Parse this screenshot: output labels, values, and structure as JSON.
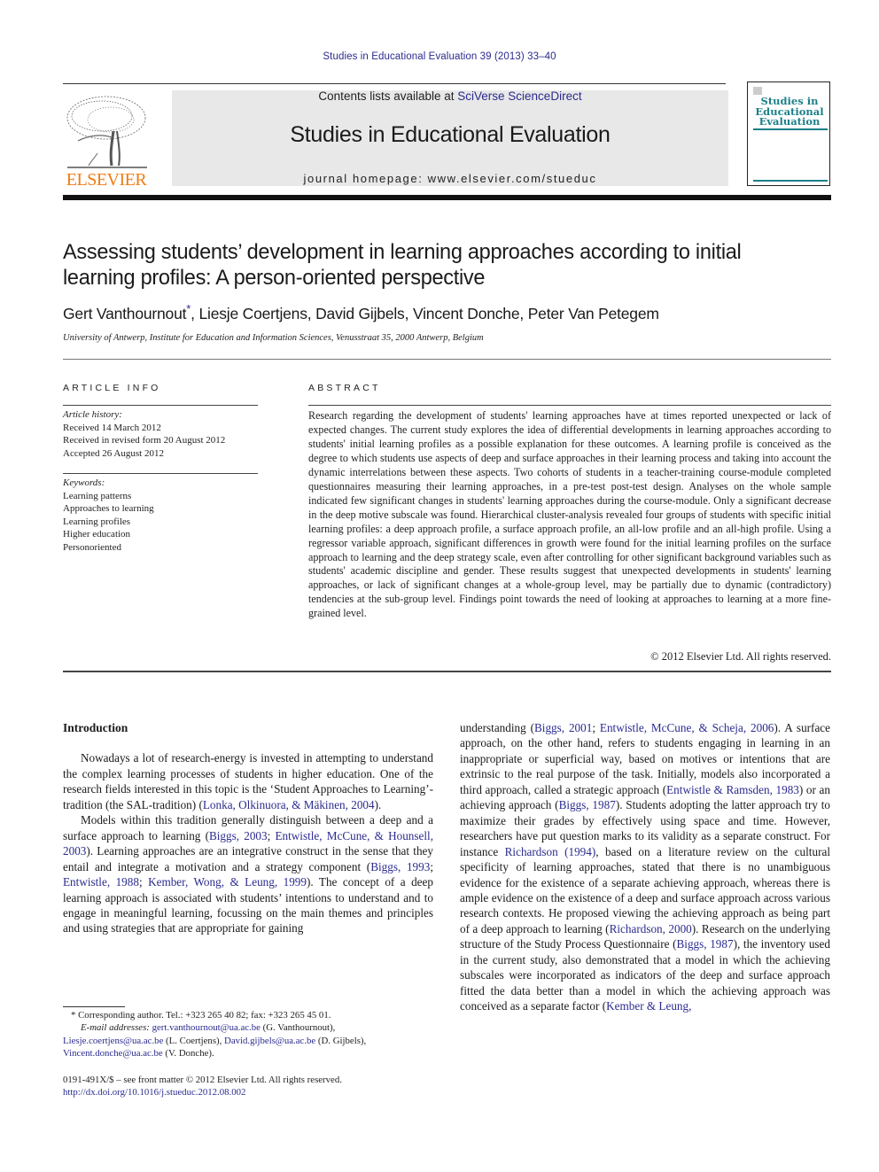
{
  "header": {
    "journal_ref": "Studies in Educational Evaluation 39 (2013) 33–40",
    "contents_prefix": "Contents lists available at ",
    "contents_link": "SciVerse ScienceDirect",
    "journal_title": "Studies in Educational Evaluation",
    "homepage": "journal homepage: www.elsevier.com/stueduc",
    "publisher_logo": "ELSEVIER",
    "cover_title": "Studies in Educational Evaluation",
    "colors": {
      "link": "#2b2b8f",
      "elsevier_orange": "#f07c14",
      "cover_teal": "#1b7f88",
      "banner_bg": "#e8e8e8"
    }
  },
  "article": {
    "title": "Assessing students’ development in learning approaches according to initial learning profiles: A person-oriented perspective",
    "authors": [
      {
        "name": "Gert Vanthournout",
        "mark": "*"
      },
      {
        "name": "Liesje Coertjens"
      },
      {
        "name": "David Gijbels"
      },
      {
        "name": "Vincent Donche"
      },
      {
        "name": "Peter Van Petegem"
      }
    ],
    "affiliation": "University of Antwerp, Institute for Education and Information Sciences, Venusstraat 35, 2000 Antwerp, Belgium"
  },
  "article_info": {
    "heading": "ARTICLE INFO",
    "history_label": "Article history:",
    "history": [
      "Received 14 March 2012",
      "Received in revised form 20 August 2012",
      "Accepted 26 August 2012"
    ],
    "keywords_label": "Keywords:",
    "keywords": [
      "Learning patterns",
      "Approaches to learning",
      "Learning profiles",
      "Higher education",
      "Personoriented"
    ]
  },
  "abstract": {
    "heading": "ABSTRACT",
    "text": "Research regarding the development of students' learning approaches have at times reported unexpected or lack of expected changes. The current study explores the idea of differential developments in learning approaches according to students' initial learning profiles as a possible explanation for these outcomes. A learning profile is conceived as the degree to which students use aspects of deep and surface approaches in their learning process and taking into account the dynamic interrelations between these aspects. Two cohorts of students in a teacher-training course-module completed questionnaires measuring their learning approaches, in a pre-test post-test design. Analyses on the whole sample indicated few significant changes in students' learning approaches during the course-module. Only a significant decrease in the deep motive subscale was found. Hierarchical cluster-analysis revealed four groups of students with specific initial learning profiles: a deep approach profile, a surface approach profile, an all-low profile and an all-high profile. Using a regressor variable approach, significant differences in growth were found for the initial learning profiles on the surface approach to learning and the deep strategy scale, even after controlling for other significant background variables such as students' academic discipline and gender. These results suggest that unexpected developments in students' learning approaches, or lack of significant changes at a whole-group level, may be partially due to dynamic (contradictory) tendencies at the sub-group level. Findings point towards the need of looking at approaches to learning at a more fine-grained level.",
    "copyright": "© 2012 Elsevier Ltd. All rights reserved."
  },
  "body": {
    "intro_heading": "Introduction",
    "p1": {
      "t1": "Nowadays a lot of research-energy is invested in attempting to understand the complex learning processes of students in higher education. One of the research fields interested in this topic is the ‘Student Approaches to Learning’-tradition (the SAL-tradition) (",
      "c1": "Lonka, Olkinuora, & Mäkinen, 2004",
      "t2": ")."
    },
    "p2": {
      "t1": "Models within this tradition generally distinguish between a deep and a surface approach to learning (",
      "c1": "Biggs, 2003",
      "s1": "; ",
      "c2": "Entwistle, McCune, & Hounsell, 2003",
      "t2": "). Learning approaches are an integrative construct in the sense that they entail and integrate a motivation and a strategy component (",
      "c3": "Biggs, 1993",
      "s2": "; ",
      "c4": "Entwistle, 1988",
      "s3": "; ",
      "c5": "Kember, Wong, & Leung, 1999",
      "t3": "). The concept of a deep learning approach is associated with students’ intentions to understand and to engage in meaningful learning, focussing on the main themes and principles and using strategies that are appropriate for gaining"
    },
    "p3": {
      "t1": "understanding (",
      "c1": "Biggs, 2001",
      "s1": "; ",
      "c2": "Entwistle, McCune, & Scheja, 2006",
      "t2": "). A surface approach, on the other hand, refers to students engaging in learning in an inappropriate or superficial way, based on motives or intentions that are extrinsic to the real purpose of the task. Initially, models also incorporated a third approach, called a strategic approach (",
      "c3": "Entwistle & Ramsden, 1983",
      "t3": ") or an achieving approach (",
      "c4": "Biggs, 1987",
      "t4": "). Students adopting the latter approach try to maximize their grades by effectively using space and time. However, researchers have put question marks to its validity as a separate construct. For instance ",
      "c5": "Richardson (1994)",
      "t5": ", based on a literature review on the cultural specificity of learning approaches, stated that there is no unambiguous evidence for the existence of a separate achieving approach, whereas there is ample evidence on the existence of a deep and surface approach across various research contexts. He proposed viewing the achieving approach as being part of a deep approach to learning (",
      "c6": "Richardson, 2000",
      "t6": "). Research on the underlying structure of the Study Process Questionnaire (",
      "c7": "Biggs, 1987",
      "t7": "), the inventory used in the current study, also demonstrated that a model in which the achieving subscales were incorporated as indicators of the deep and surface approach fitted the data better than a model in which the achieving approach was conceived as a separate factor (",
      "c8": "Kember & Leung,"
    }
  },
  "footnotes": {
    "corresponding": "* Corresponding author. Tel.: +323 265 40 82; fax: +323 265 45 01.",
    "email_label": "E-mail addresses:",
    "emails": [
      {
        "address": "gert.vanthournout@ua.ac.be",
        "who": " (G. Vanthournout),"
      },
      {
        "address": "Liesje.coertjens@ua.ac.be",
        "who": " (L. Coertjens), "
      },
      {
        "address": "David.gijbels@ua.ac.be",
        "who": " (D. Gijbels),"
      },
      {
        "address": "Vincent.donche@ua.ac.be",
        "who": " (V. Donche)."
      }
    ],
    "front_matter": "0191-491X/$ – see front matter © 2012 Elsevier Ltd. All rights reserved.",
    "doi": "http://dx.doi.org/10.1016/j.stueduc.2012.08.002"
  }
}
